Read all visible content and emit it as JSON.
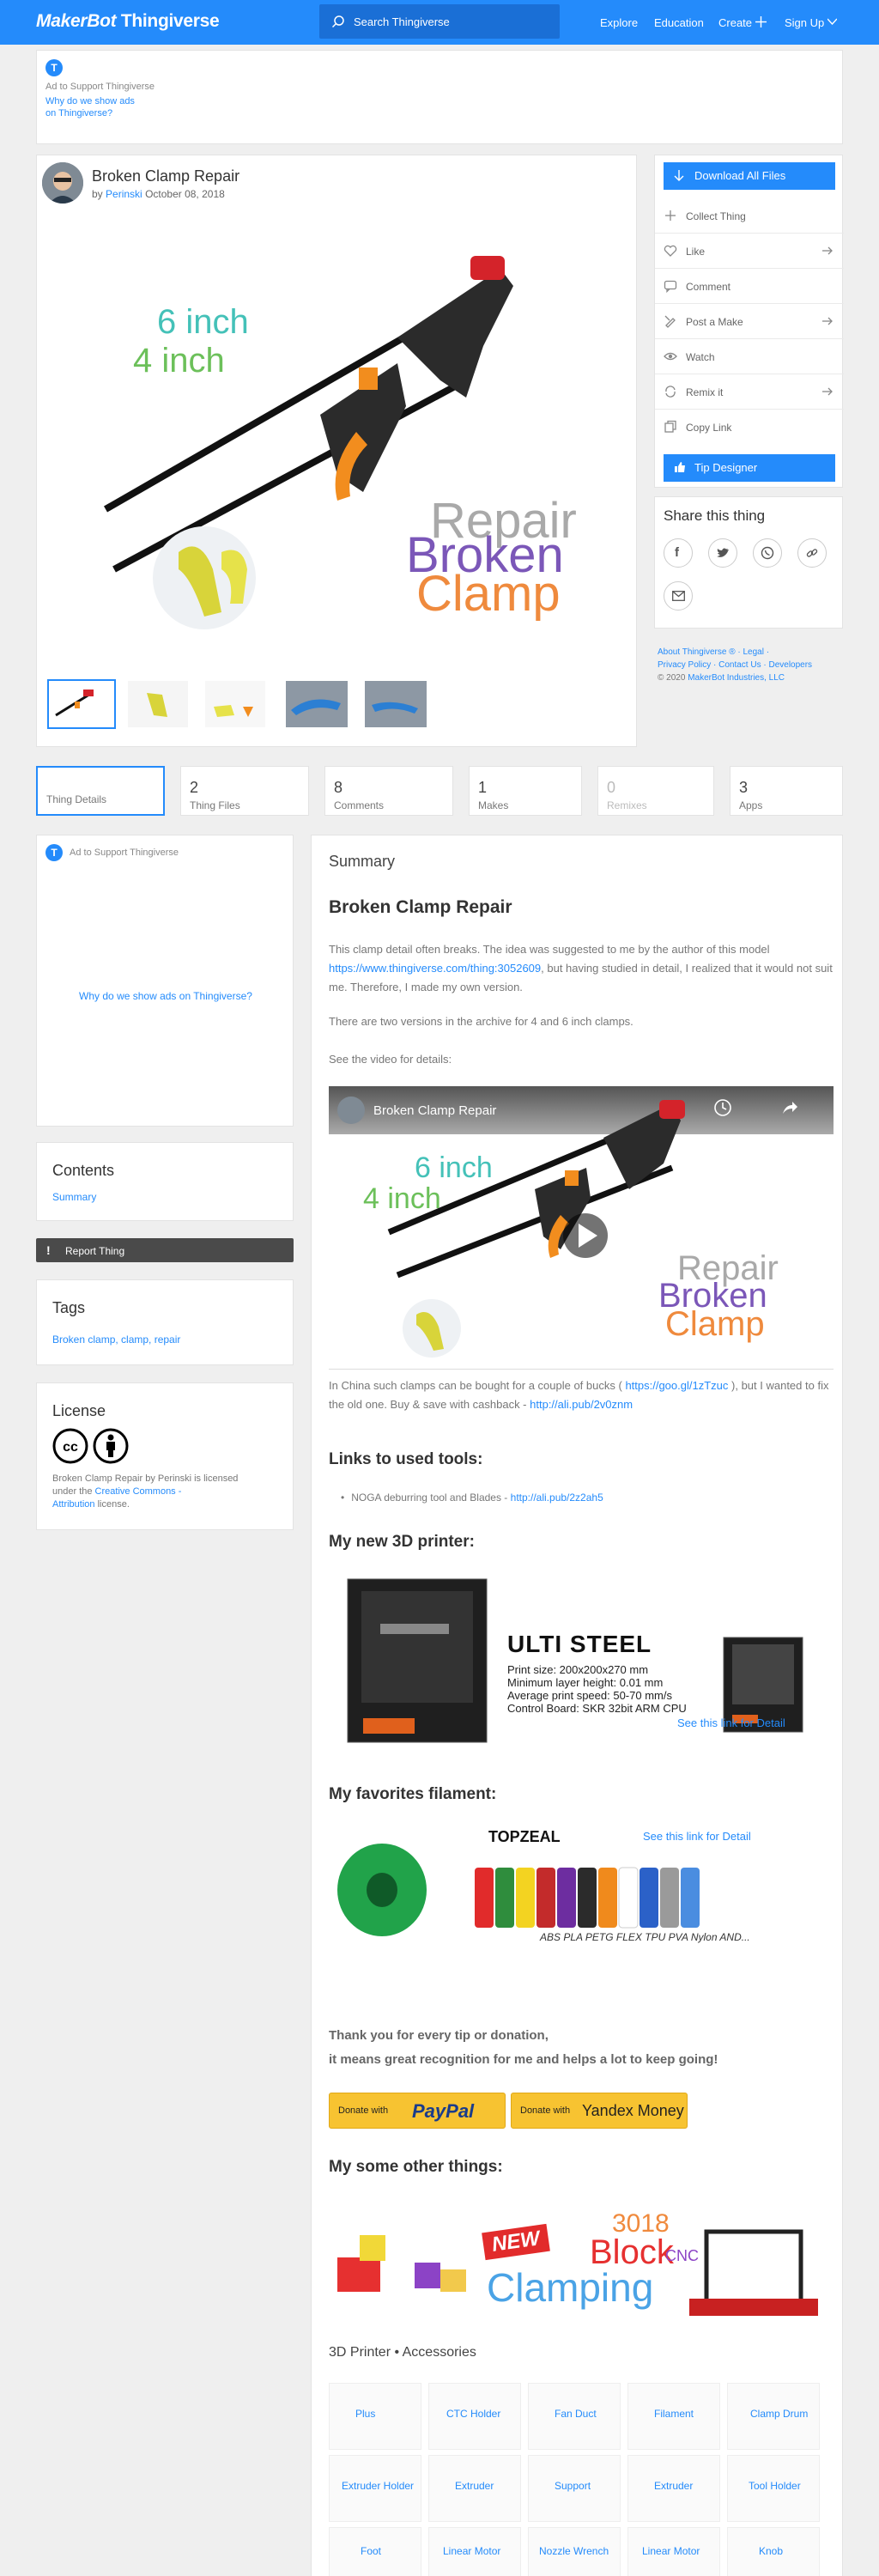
{
  "header": {
    "logo_brand": "MakerBot",
    "logo_product": "Thingiverse",
    "search_placeholder": "Search Thingiverse",
    "nav": [
      "Explore",
      "Education",
      "Create",
      "Sign Up"
    ]
  },
  "top_ad": {
    "label": "Ad to Support Thingiverse",
    "link_line1": "Why do we show ads",
    "link_line2": "on Thingiverse?"
  },
  "thing": {
    "title": "Broken Clamp Repair",
    "by": "by",
    "author": "Perinski",
    "date": "October 08, 2018",
    "hero_text": {
      "line6": "6 inch",
      "line4": "4 inch",
      "w1": "Repair",
      "w2": "Broken",
      "w3": "Clamp"
    }
  },
  "actions": {
    "download": "Download All Files",
    "items": [
      "Collect Thing",
      "Like",
      "Comment",
      "Post a Make",
      "Watch",
      "Remix it",
      "Copy Link"
    ],
    "tip": "Tip Designer"
  },
  "share": {
    "title": "Share this thing",
    "icons": [
      "facebook-icon",
      "twitter-icon",
      "whatsapp-icon",
      "link-icon",
      "email-icon"
    ]
  },
  "footer_links": {
    "line1": "About Thingiverse ® · Legal ·",
    "line2": "Privacy Policy · Contact Us · Developers",
    "line3_prefix": "© 2020",
    "line3_link": "MakerBot Industries, LLC"
  },
  "tabs": [
    {
      "num": "",
      "label": "Thing Details"
    },
    {
      "num": "2",
      "label": "Thing Files"
    },
    {
      "num": "8",
      "label": "Comments"
    },
    {
      "num": "1",
      "label": "Makes"
    },
    {
      "num": "0",
      "label": "Remixes"
    },
    {
      "num": "3",
      "label": "Apps"
    }
  ],
  "side_ad": {
    "label": "Ad to Support Thingiverse",
    "link": "Why do we show ads on Thingiverse?"
  },
  "contents": {
    "title": "Contents",
    "item": "Summary"
  },
  "report": "Report Thing",
  "tags": {
    "title": "Tags",
    "list": "Broken clamp, clamp, repair"
  },
  "license": {
    "title": "License",
    "t1": "Broken Clamp Repair by Perinski is licensed",
    "t2": "under the",
    "link": "Creative Commons -",
    "link2": "Attribution",
    "t3": "license."
  },
  "summary": {
    "section_title": "Summary",
    "heading": "Broken Clamp Repair",
    "p1a": "This clamp detail often breaks. The idea was suggested to me by the author of this model",
    "p1_link": "https://www.thingiverse.com/thing:3052609",
    "p1b": ", but having studied in detail, I realized that it would",
    "p1c": "not suit me. Therefore, I made my own version.",
    "p2": "There are two versions in the archive for 4 and 6 inch clamps.",
    "p3": "See the video for details:",
    "video_title": "Broken Clamp Repair",
    "p4a": "In China such clamps can be bought for a couple of bucks (",
    "p4_link": "https://goo.gl/1zTzuc",
    "p4b": "), but I wanted",
    "p4c": "to fix the old one. Buy & save with cashback -",
    "p4_link2": "http://ali.pub/2v0znm",
    "tools_title": "Links to used tools:",
    "tool_item": "NOGA deburring tool and Blades -",
    "tool_link": "http://ali.pub/2z2ah5",
    "printer_title": "My new 3D printer:",
    "printer_brand": "ULTI STEEL",
    "printer_specs": [
      "Print size: 200x200x270 mm",
      "Minimum layer height: 0.01 mm",
      "Average print speed: 50-70 mm/s",
      "Control Board: SKR 32bit ARM CPU"
    ],
    "printer_link": "See this link for Detail",
    "filament_title": "My favorites filament:",
    "filament_brand": "TOPZEAL",
    "filament_link": "See this link for Detail",
    "filament_types": "ABS PLA PETG FLEX TPU PVA Nylon AND...",
    "thanks1": "Thank you for every tip or donation,",
    "thanks2": "it means great recognition for me and helps a lot to keep going!",
    "donate1_prefix": "Donate with",
    "donate1_brand": "PayPal",
    "donate2_prefix": "Donate with",
    "donate2_brand": "Yandex Money",
    "other_title": "My some other things:",
    "banner_new": "NEW",
    "banner_3018": "3018",
    "banner_block": "Block",
    "banner_cnc": "CNC",
    "banner_clamping": "Clamping",
    "accessories": "3D Printer • Accessories"
  },
  "accessory_thumbs": [
    [
      "Plus",
      "CTC Holder",
      "Fan Duct",
      "Filament",
      "Clamp Drum"
    ],
    [
      "Extruder Holder",
      "Extruder",
      "Support",
      "Extruder",
      "Tool Holder"
    ],
    [
      "Foot",
      "Linear Motor",
      "Nozzle Wrench",
      "Linear Motor",
      "Knob"
    ]
  ]
}
